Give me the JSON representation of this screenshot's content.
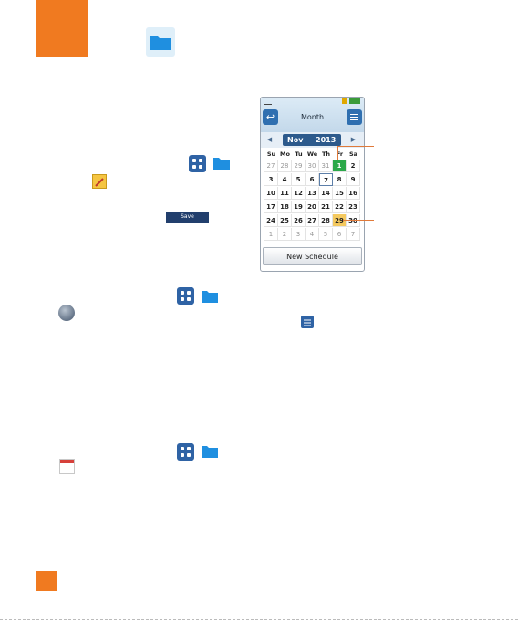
{
  "phone": {
    "header_title": "Month",
    "month": "Nov",
    "year": "2013",
    "weekdays": [
      "Su",
      "Mo",
      "Tu",
      "We",
      "Th",
      "Fr",
      "Sa"
    ],
    "weeks": [
      [
        "27",
        "28",
        "29",
        "30",
        "31",
        "1",
        "2"
      ],
      [
        "3",
        "4",
        "5",
        "6",
        "7",
        "8",
        "9"
      ],
      [
        "10",
        "11",
        "12",
        "13",
        "14",
        "15",
        "16"
      ],
      [
        "17",
        "18",
        "19",
        "20",
        "21",
        "22",
        "23"
      ],
      [
        "24",
        "25",
        "26",
        "27",
        "28",
        "29",
        "30"
      ],
      [
        "1",
        "2",
        "3",
        "4",
        "5",
        "6",
        "7"
      ]
    ],
    "new_schedule": "New Schedule",
    "colors": {
      "today": "#2ca84a",
      "selected": "#f4c95f",
      "nav": "#2d5a8c"
    }
  },
  "save_button": "Save",
  "colors": {
    "accent": "#f07a20"
  },
  "icons": [
    "folder-icon",
    "apps-grid-icon",
    "memo-icon",
    "globe-icon",
    "menu-icon",
    "calendar-icon",
    "back-icon"
  ]
}
